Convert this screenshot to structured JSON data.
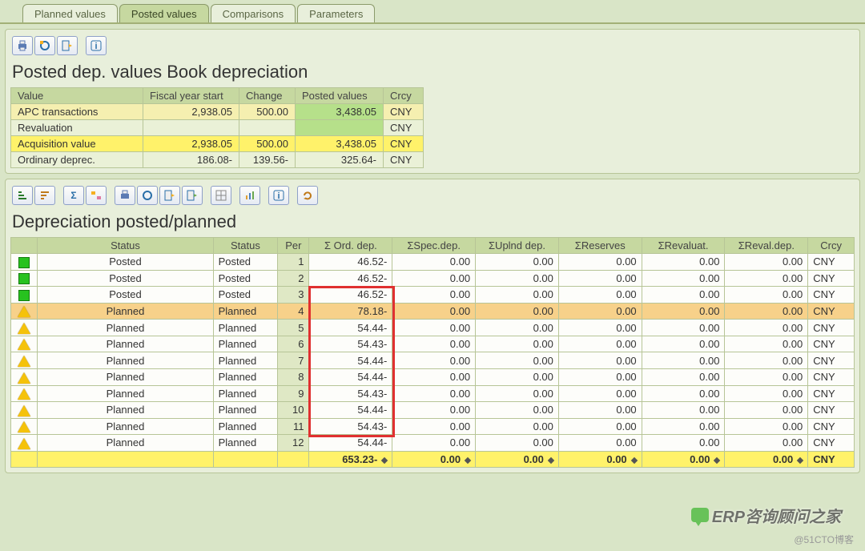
{
  "tabs": [
    "Planned values",
    "Posted values",
    "Comparisons",
    "Parameters"
  ],
  "activeTab": 1,
  "top": {
    "title": "Posted dep. values Book depreciation",
    "headers": [
      "Value",
      "Fiscal year start",
      "Change",
      "Posted values",
      "Crcy"
    ],
    "rows": [
      {
        "cls": "row-apc",
        "label": "APC transactions",
        "fys": "2,938.05",
        "chg": "500.00",
        "pv": "3,438.05",
        "cr": "CNY"
      },
      {
        "cls": "row-reval",
        "label": "Revaluation",
        "fys": "",
        "chg": "",
        "pv": "",
        "cr": "CNY"
      },
      {
        "cls": "row-acq",
        "label": "Acquisition value",
        "fys": "2,938.05",
        "chg": "500.00",
        "pv": "3,438.05",
        "cr": "CNY"
      },
      {
        "cls": "row-ord",
        "label": "Ordinary deprec.",
        "fys": "186.08-",
        "chg": "139.56-",
        "pv": "325.64-",
        "cr": "CNY"
      }
    ]
  },
  "dep": {
    "title": "Depreciation posted/planned",
    "headers": [
      "",
      "Status",
      "Status",
      "Per",
      "Σ  Ord. dep.",
      "ΣSpec.dep.",
      "ΣUplnd dep.",
      "ΣReserves",
      "ΣRevaluat.",
      "ΣReval.dep.",
      "Crcy"
    ],
    "rows": [
      {
        "ic": "sq",
        "st": "Posted",
        "st2": "Posted",
        "per": "1",
        "ord": "46.52-",
        "sp": "0.00",
        "up": "0.00",
        "rs": "0.00",
        "rv": "0.00",
        "rd": "0.00",
        "cr": "CNY"
      },
      {
        "ic": "sq",
        "st": "Posted",
        "st2": "Posted",
        "per": "2",
        "ord": "46.52-",
        "sp": "0.00",
        "up": "0.00",
        "rs": "0.00",
        "rv": "0.00",
        "rd": "0.00",
        "cr": "CNY"
      },
      {
        "ic": "sq",
        "st": "Posted",
        "st2": "Posted",
        "per": "3",
        "ord": "46.52-",
        "sp": "0.00",
        "up": "0.00",
        "rs": "0.00",
        "rv": "0.00",
        "rd": "0.00",
        "cr": "CNY"
      },
      {
        "ic": "tri",
        "st": "Planned",
        "st2": "Planned",
        "per": "4",
        "ord": "78.18-",
        "sp": "0.00",
        "up": "0.00",
        "rs": "0.00",
        "rv": "0.00",
        "rd": "0.00",
        "cr": "CNY",
        "hl": true
      },
      {
        "ic": "tri",
        "st": "Planned",
        "st2": "Planned",
        "per": "5",
        "ord": "54.44-",
        "sp": "0.00",
        "up": "0.00",
        "rs": "0.00",
        "rv": "0.00",
        "rd": "0.00",
        "cr": "CNY"
      },
      {
        "ic": "tri",
        "st": "Planned",
        "st2": "Planned",
        "per": "6",
        "ord": "54.43-",
        "sp": "0.00",
        "up": "0.00",
        "rs": "0.00",
        "rv": "0.00",
        "rd": "0.00",
        "cr": "CNY"
      },
      {
        "ic": "tri",
        "st": "Planned",
        "st2": "Planned",
        "per": "7",
        "ord": "54.44-",
        "sp": "0.00",
        "up": "0.00",
        "rs": "0.00",
        "rv": "0.00",
        "rd": "0.00",
        "cr": "CNY"
      },
      {
        "ic": "tri",
        "st": "Planned",
        "st2": "Planned",
        "per": "8",
        "ord": "54.44-",
        "sp": "0.00",
        "up": "0.00",
        "rs": "0.00",
        "rv": "0.00",
        "rd": "0.00",
        "cr": "CNY"
      },
      {
        "ic": "tri",
        "st": "Planned",
        "st2": "Planned",
        "per": "9",
        "ord": "54.43-",
        "sp": "0.00",
        "up": "0.00",
        "rs": "0.00",
        "rv": "0.00",
        "rd": "0.00",
        "cr": "CNY"
      },
      {
        "ic": "tri",
        "st": "Planned",
        "st2": "Planned",
        "per": "10",
        "ord": "54.44-",
        "sp": "0.00",
        "up": "0.00",
        "rs": "0.00",
        "rv": "0.00",
        "rd": "0.00",
        "cr": "CNY"
      },
      {
        "ic": "tri",
        "st": "Planned",
        "st2": "Planned",
        "per": "11",
        "ord": "54.43-",
        "sp": "0.00",
        "up": "0.00",
        "rs": "0.00",
        "rv": "0.00",
        "rd": "0.00",
        "cr": "CNY"
      },
      {
        "ic": "tri",
        "st": "Planned",
        "st2": "Planned",
        "per": "12",
        "ord": "54.44-",
        "sp": "0.00",
        "up": "0.00",
        "rs": "0.00",
        "rv": "0.00",
        "rd": "0.00",
        "cr": "CNY"
      }
    ],
    "total": {
      "ord": "653.23-",
      "sp": "0.00",
      "up": "0.00",
      "rs": "0.00",
      "rv": "0.00",
      "rd": "0.00",
      "cr": "CNY"
    }
  },
  "wm1": "@51CTO博客",
  "wm2": "ERP咨询顾问之家"
}
